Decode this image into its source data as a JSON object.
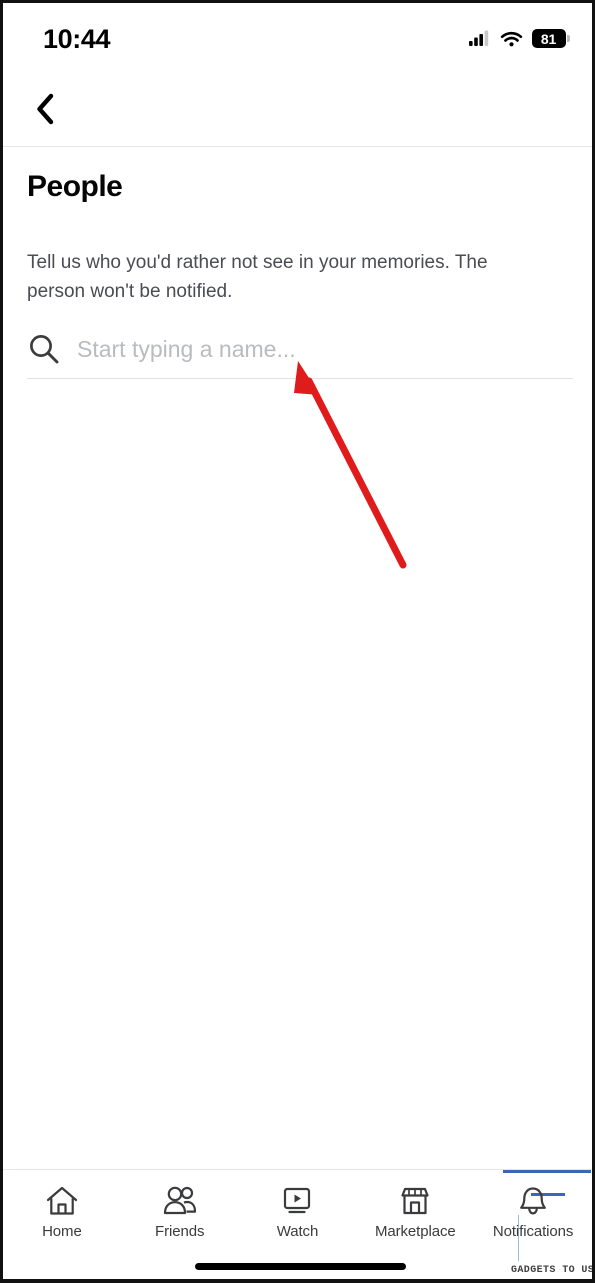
{
  "status_bar": {
    "time": "10:44",
    "cellular_icon": "signal-bars-icon",
    "wifi_icon": "wifi-icon",
    "battery_level": "81",
    "battery_icon": "battery-icon"
  },
  "nav_header": {
    "back_icon": "chevron-left-icon"
  },
  "main": {
    "title": "People",
    "description": "Tell us who you'd rather not see in your memories. The person won't be notified."
  },
  "search": {
    "icon": "search-icon",
    "placeholder": "Start typing a name...",
    "value": ""
  },
  "annotation": {
    "arrow_icon": "red-arrow-icon",
    "arrow_color": "#e01b1b",
    "blue_color": "#3b67b5",
    "watermark": "GADGETS TO USE"
  },
  "bottom_nav": {
    "items": [
      {
        "label": "Home",
        "icon": "home-icon"
      },
      {
        "label": "Friends",
        "icon": "friends-icon"
      },
      {
        "label": "Watch",
        "icon": "watch-icon"
      },
      {
        "label": "Marketplace",
        "icon": "marketplace-icon"
      },
      {
        "label": "Notifications",
        "icon": "bell-icon"
      }
    ]
  },
  "home_indicator": {
    "icon": "home-indicator-bar"
  }
}
